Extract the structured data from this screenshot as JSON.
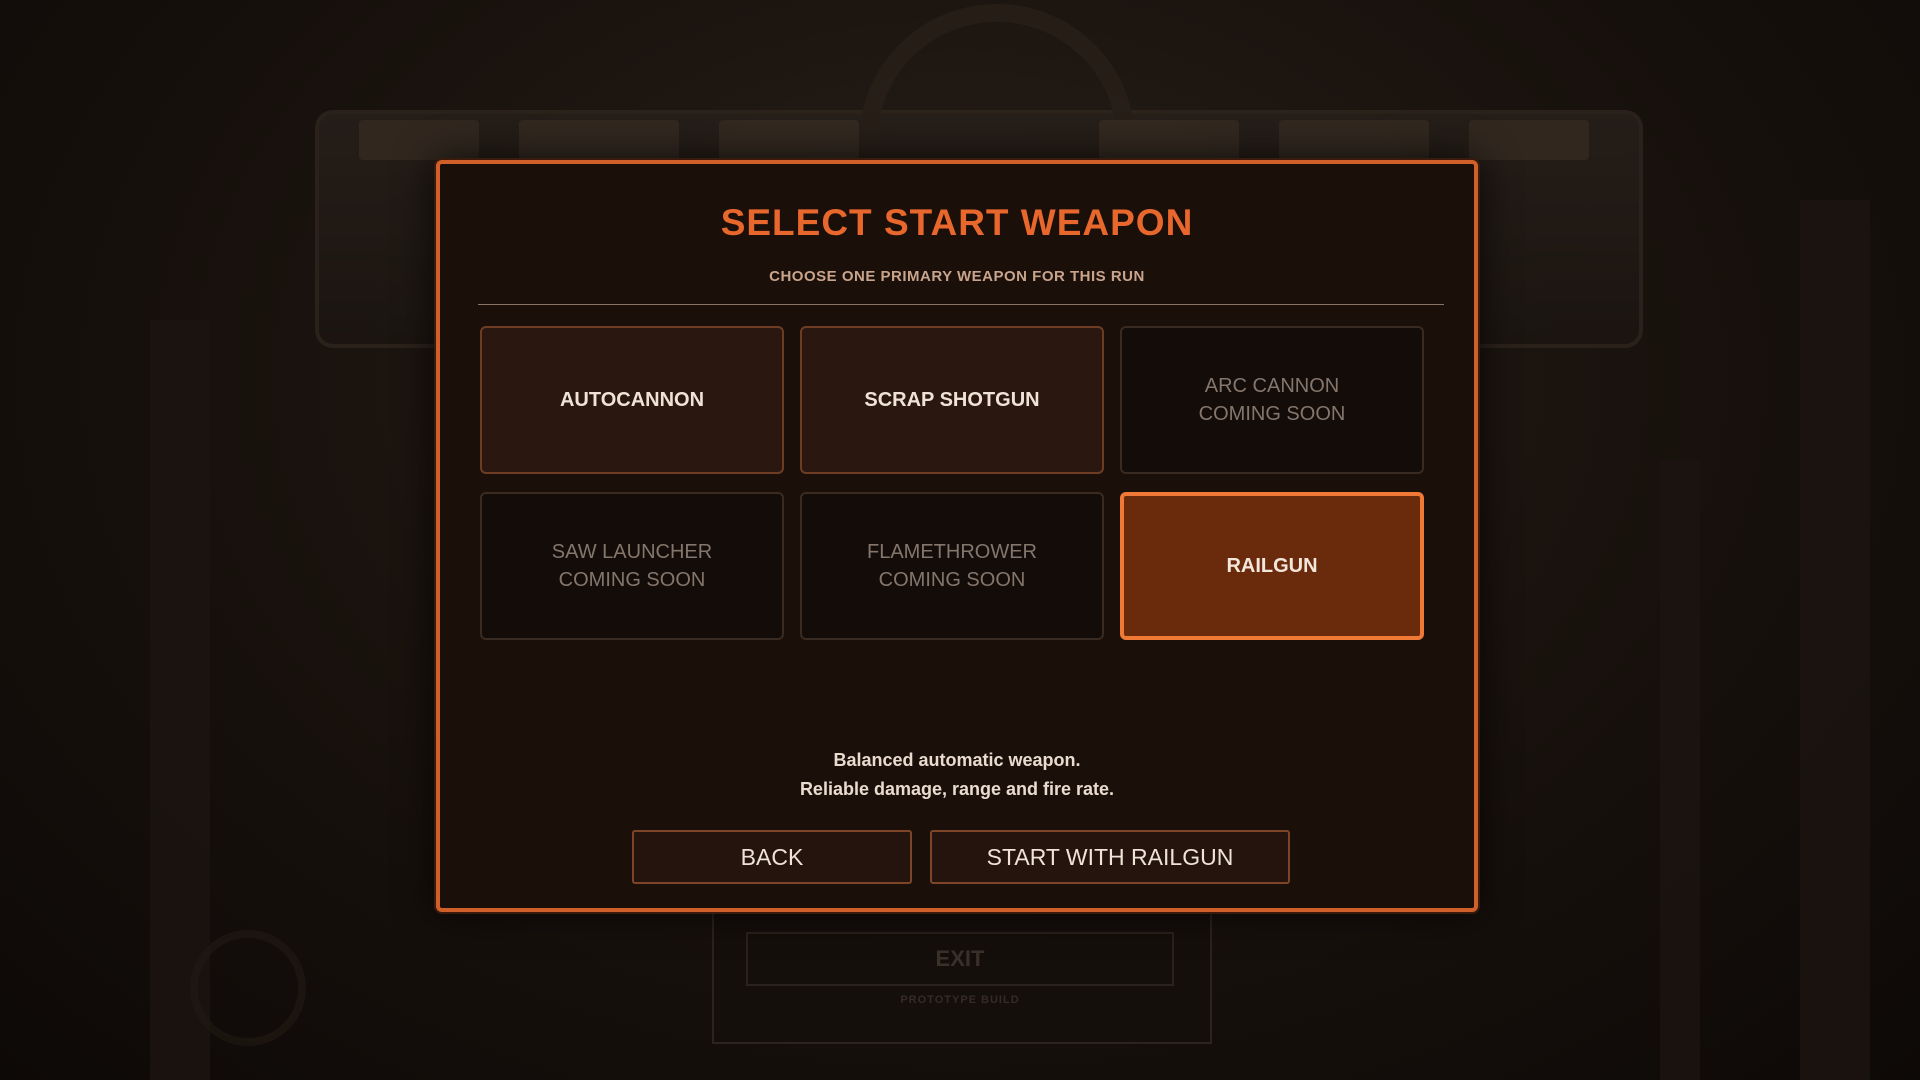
{
  "background": {
    "exit_label": "EXIT",
    "build_label": "PROTOTYPE BUILD"
  },
  "dialog": {
    "title": "SELECT START WEAPON",
    "subtitle": "CHOOSE ONE PRIMARY WEAPON FOR THIS RUN",
    "weapons": [
      {
        "name": "AUTOCANNON",
        "status": "",
        "state": "available"
      },
      {
        "name": "SCRAP SHOTGUN",
        "status": "",
        "state": "available"
      },
      {
        "name": "ARC CANNON",
        "status": "COMING SOON",
        "state": "locked"
      },
      {
        "name": "SAW LAUNCHER",
        "status": "COMING SOON",
        "state": "locked"
      },
      {
        "name": "FLAMETHROWER",
        "status": "COMING SOON",
        "state": "locked"
      },
      {
        "name": "RAILGUN",
        "status": "",
        "state": "selected"
      }
    ],
    "description": {
      "line1": "Balanced automatic weapon.",
      "line2": "Reliable damage, range and fire rate."
    },
    "back_label": "BACK",
    "start_label": "START WITH RAILGUN"
  },
  "colors": {
    "accent": "#e8672c",
    "selected_fill": "#6a2a0c",
    "panel_bg": "#1b0f0a"
  }
}
